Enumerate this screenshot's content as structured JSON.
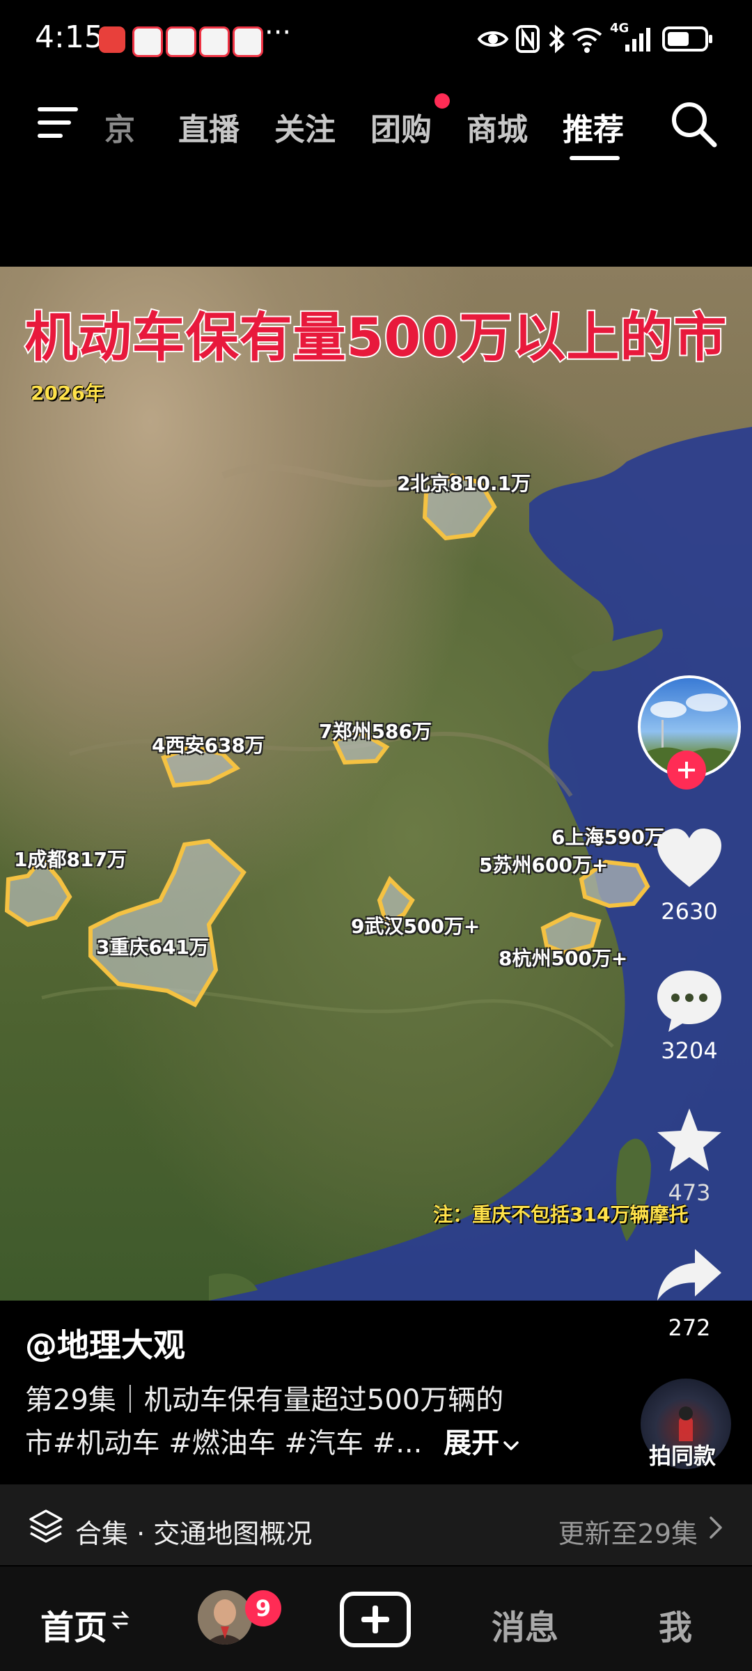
{
  "status_bar": {
    "time": "4:15",
    "more": "···",
    "network": "4G"
  },
  "top_nav": {
    "tabs": [
      "京",
      "直播",
      "关注",
      "团购",
      "商城",
      "推荐"
    ],
    "active_tab": "推荐"
  },
  "video": {
    "title": "机动车保有量500万以上的市",
    "year": "2026年",
    "cities": [
      {
        "label": "2北京810.1万"
      },
      {
        "label": "4西安638万"
      },
      {
        "label": "7郑州586万"
      },
      {
        "label": "6上海590万"
      },
      {
        "label": "1成都817万"
      },
      {
        "label": "5苏州600万+"
      },
      {
        "label": "9武汉500万+"
      },
      {
        "label": "3重庆641万"
      },
      {
        "label": "8杭州500万+"
      }
    ],
    "note": "注：重庆不包括314万辆摩托"
  },
  "actions": {
    "likes": "2630",
    "comments": "3204",
    "favorites": "473",
    "shares": "272",
    "same_style": "拍同款"
  },
  "caption": {
    "author": "@地理大观",
    "line1": "第29集｜机动车保有量超过500万辆的",
    "line2": "市#机动车 #燃油车 #汽车 #...",
    "expand": "展开"
  },
  "collection": {
    "text": "合集 · 交通地图概况",
    "update": "更新至29集"
  },
  "bottom_nav": {
    "home": "首页",
    "badge": "9",
    "messages": "消息",
    "me": "我"
  },
  "colors": {
    "accent": "#ff2c55",
    "title_red": "#e8193c",
    "label_yellow": "#ffe24a",
    "city_outline": "#f5c242"
  }
}
